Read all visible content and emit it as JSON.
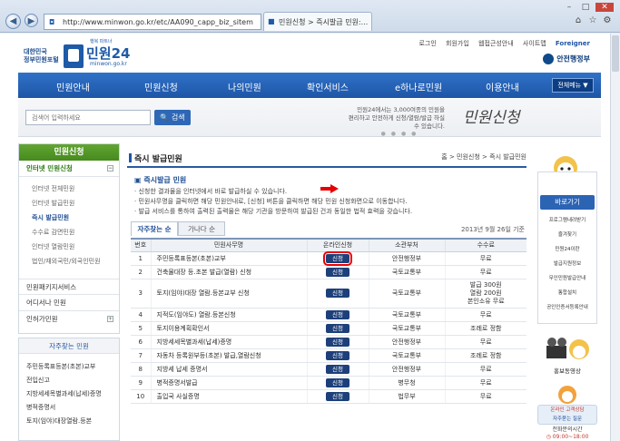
{
  "browser": {
    "url": "http://www.minwon.go.kr/etc/AA090_capp_biz_sitem",
    "tab_title": "민원신청 > 즉시발급 민원:..."
  },
  "header": {
    "top_links": [
      "로그인",
      "회원가입",
      "웹접근성안내",
      "사이트맵",
      "Foreigner"
    ],
    "logo_left": "대한민국\n정부민원포털",
    "logo_tagline": "행복 파트너",
    "logo_name": "민원24",
    "logo_url": "minwon.go.kr",
    "gov_name": "안전행정부"
  },
  "gnb": {
    "items": [
      "민원안내",
      "민원신청",
      "나의민원",
      "확인서비스",
      "e하나로민원",
      "이용안내"
    ],
    "all_menu": "전체메뉴 ▼"
  },
  "search": {
    "placeholder": "검색어 입력하세요",
    "button": "검색"
  },
  "promo": {
    "line1": "민원24에서는 3,000여종의 민원을",
    "line2": "편리하고 안전하게 신청/열람/발급 하실 수 있습니다.",
    "title": "민원신청"
  },
  "sidebar": {
    "head": "민원신청",
    "main_item": "인터넷 민원신청",
    "sub_items": [
      "인터넷 전체민원",
      "인터넷 발급민원",
      "즉시 발급민원",
      "수수료 감면민원",
      "인터넷 열람민원",
      "법인/재외국민/외국인민원"
    ],
    "other_items": [
      "민원패키지서비스",
      "어디서나 민원",
      "인허가민원"
    ]
  },
  "frequent": {
    "head": "자주찾는 민원",
    "items": [
      "주민등록표등본(초본)교부",
      "전입신고",
      "지방세세목별과세(납세)증명",
      "병적증명서",
      "토지(임야)대장열람.등본"
    ]
  },
  "content": {
    "page_title": "즉시 발급민원",
    "breadcrumb": "홈 > 민원신청 > 즉시 발급민원",
    "section_title": "즉시발급 민원",
    "desc": [
      "· 신청한 결과물을 인터넷에서 바로 발급하실 수 있습니다.",
      "· 민원사무명을 클릭하면 해당 민원안내로, [신청] 버튼을 클릭하면 해당 민원 신청화면으로 이동합니다.",
      "· 발급 서비스를 통하여 출력된 출력물은 해당 기관을 방문하여 발급된 건과 동일한 법적 효력을 갖습니다."
    ],
    "tabs": [
      "자주찾는 순",
      "가나다 순"
    ],
    "date": "2013년 9월 26일 기준",
    "columns": [
      "번호",
      "민원사무명",
      "온라인신청",
      "소관부처",
      "수수료"
    ],
    "apply_label": "신청",
    "rows": [
      {
        "no": "1",
        "name": "주민등록표등본(초본)교부",
        "dept": "안전행정부",
        "fee": "무료"
      },
      {
        "no": "2",
        "name": "건축물대장 등.초본 발급(열람) 신청",
        "dept": "국토교통부",
        "fee": "무료"
      },
      {
        "no": "3",
        "name": "토지(임야)대장 열람.등본교부 신청",
        "dept": "국토교통부",
        "fee": "발급 300원\n열람 200원\n본인소유 무료"
      },
      {
        "no": "4",
        "name": "지적도(임야도) 열람.등본신청",
        "dept": "국토교통부",
        "fee": "무료"
      },
      {
        "no": "5",
        "name": "토지이용계획확인서",
        "dept": "국토교통부",
        "fee": "조례로 정함"
      },
      {
        "no": "6",
        "name": "지방세세목별과세(납세)증명",
        "dept": "안전행정부",
        "fee": "무료"
      },
      {
        "no": "7",
        "name": "자동차 등록원부등(초본) 발급,열람신청",
        "dept": "국토교통부",
        "fee": "조례로 정함"
      },
      {
        "no": "8",
        "name": "지방세 납세 증명서",
        "dept": "안전행정부",
        "fee": "무료"
      },
      {
        "no": "9",
        "name": "병적증명서발급",
        "dept": "병무청",
        "fee": "무료"
      },
      {
        "no": "10",
        "name": "출입국 사실증명",
        "dept": "법무부",
        "fee": "무료"
      }
    ]
  },
  "quickbar": {
    "head": "바로가기",
    "items": [
      "프로그램내려받기",
      "즐겨찾기",
      "민원24이란",
      "발급지원정보",
      "무인민원발급안내",
      "통합설치",
      "공인인증서등록안내"
    ]
  },
  "video": {
    "label": "홍보동영상"
  },
  "consult": {
    "line1": "온라인 고객상담",
    "line2": "자주묻는 질문",
    "phone_label": "전화문의시간",
    "phone_time": "09:00~18:00"
  }
}
